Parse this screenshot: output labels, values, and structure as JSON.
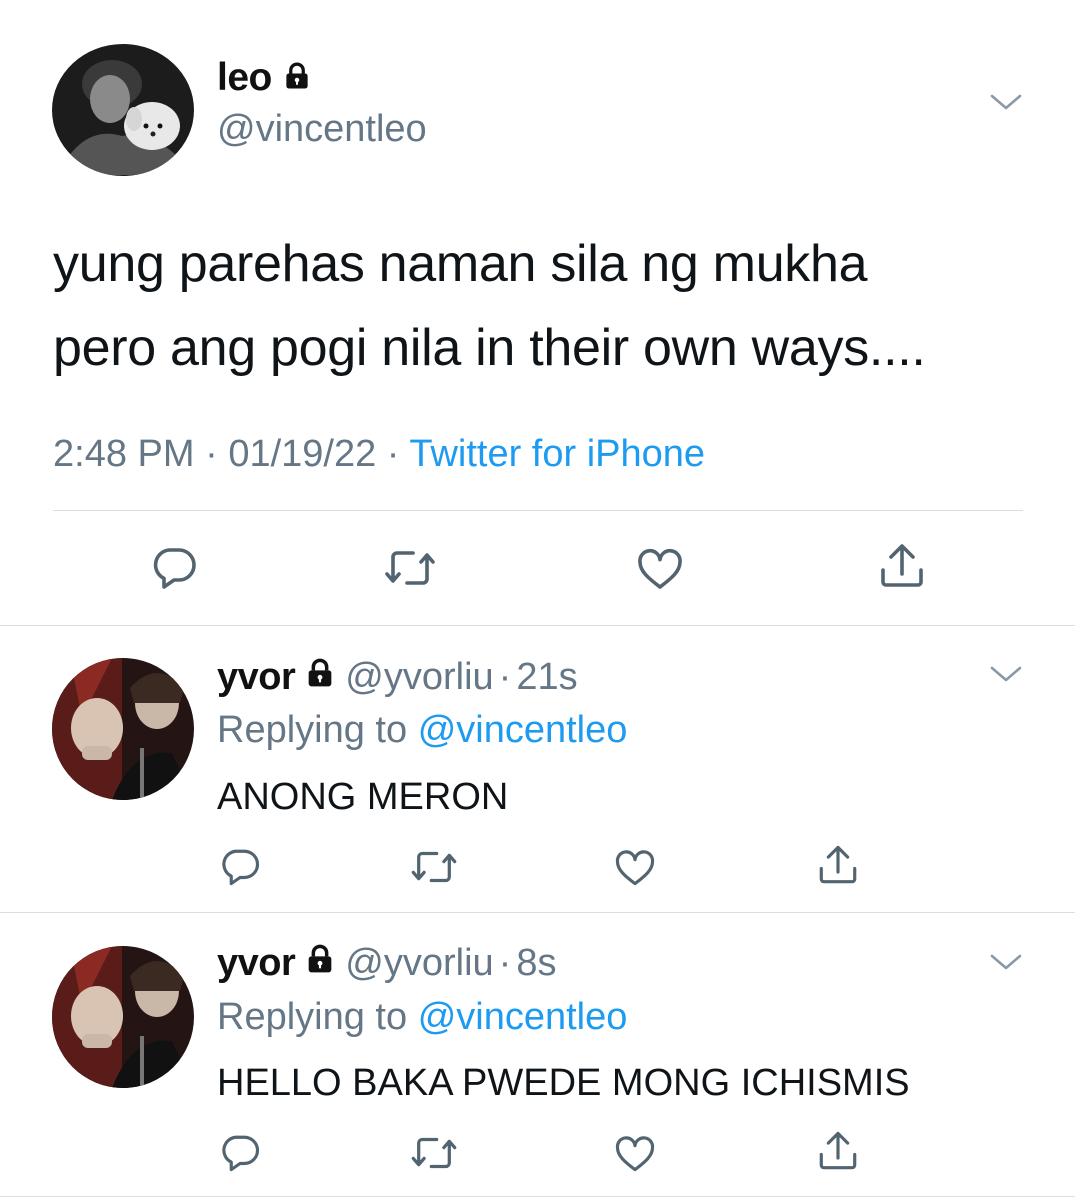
{
  "main_tweet": {
    "name": "leo",
    "handle": "@vincentleo",
    "text_line1": "yung parehas naman sila ng mukha",
    "text_line2": "pero ang pogi nila in their own ways....",
    "time": "2:48 PM",
    "date": "01/19/22",
    "source": "Twitter for iPhone",
    "sep": "·"
  },
  "replies": [
    {
      "name": "yvor",
      "handle": "@yvorliu",
      "age": "21s",
      "replying_prefix": "Replying to",
      "replying_to": "@vincentleo",
      "text": "ANONG MERON"
    },
    {
      "name": "yvor",
      "handle": "@yvorliu",
      "age": "8s",
      "replying_prefix": "Replying to",
      "replying_to": "@vincentleo",
      "text": "HELLO BAKA PWEDE MONG ICHISMIS"
    }
  ],
  "icons": {
    "reply": "reply-icon",
    "retweet": "retweet-icon",
    "like": "like-icon",
    "share": "share-icon",
    "lock": "lock-icon",
    "more": "chevron-down-icon"
  },
  "colors": {
    "link_blue": "#1d9bf0",
    "secondary_grey": "#657786",
    "icon_grey": "#536471",
    "divider": "#d9dee2"
  }
}
